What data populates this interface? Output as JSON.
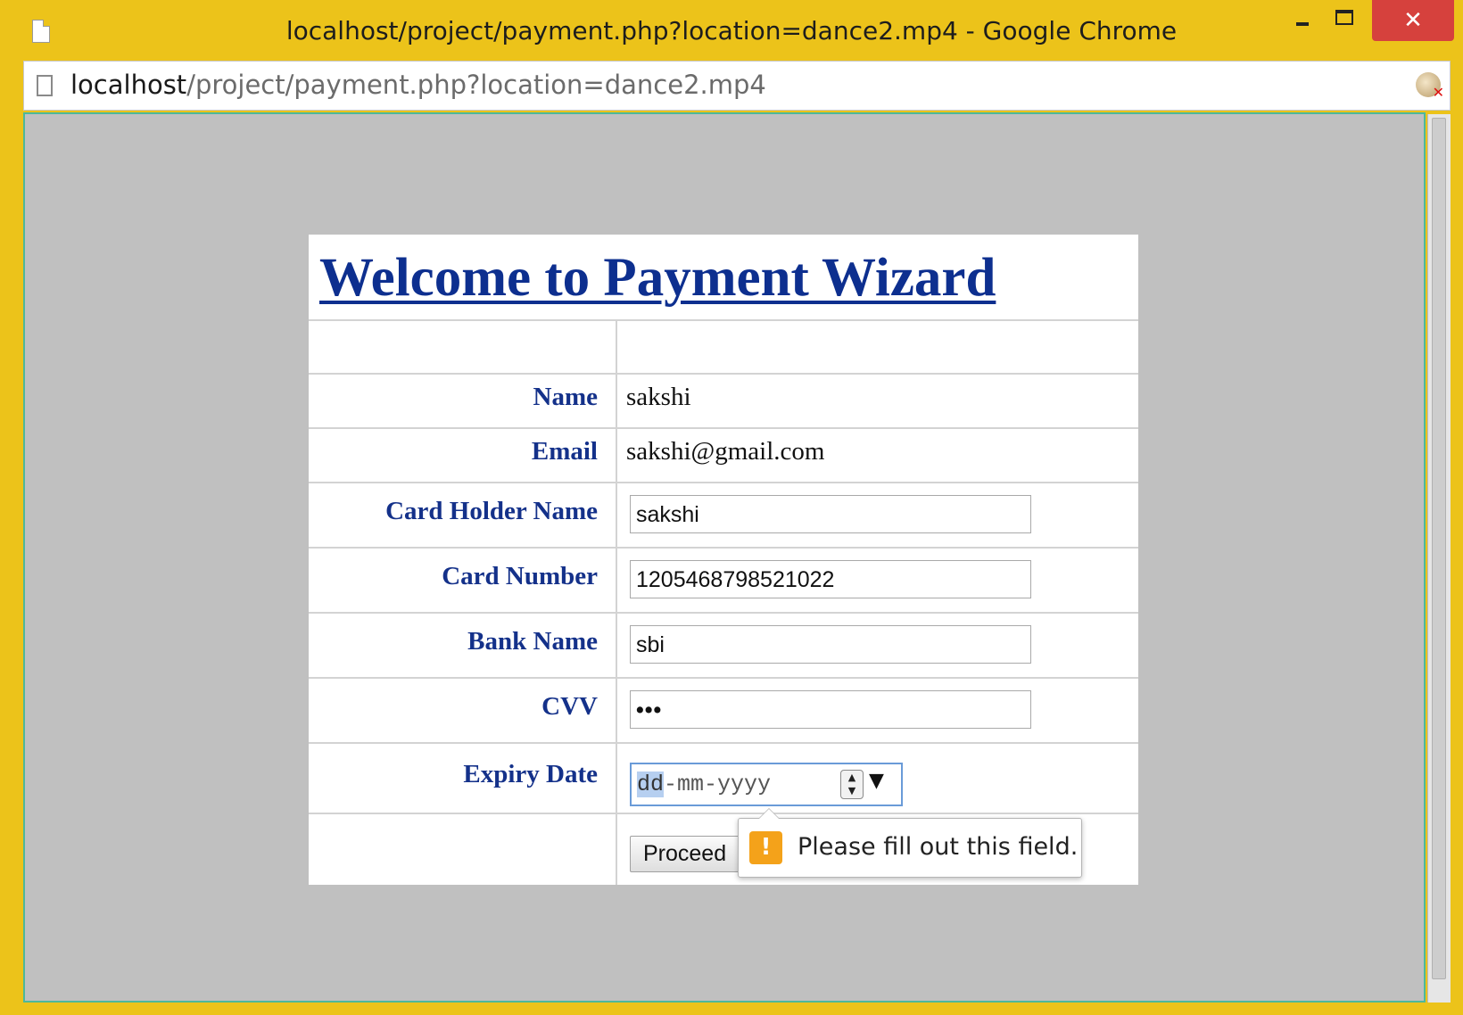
{
  "window": {
    "title": "localhost/project/payment.php?location=dance2.mp4 - Google Chrome",
    "close_glyph": "✕"
  },
  "addressbar": {
    "host": "localhost",
    "path": "/project/payment.php?location=dance2.mp4"
  },
  "page": {
    "heading": "Welcome to Payment Wizard",
    "name_label": "Name",
    "name_value": "sakshi",
    "email_label": "Email",
    "email_value": "sakshi@gmail.com",
    "cardholder_label": "Card Holder Name",
    "cardholder_value": "sakshi",
    "cardnumber_label": "Card Number",
    "cardnumber_value": "1205468798521022",
    "bankname_label": "Bank Name",
    "bankname_value": "sbi",
    "cvv_label": "CVV",
    "cvv_value": "•••",
    "expiry_label": "Expiry Date",
    "expiry_dd": "dd",
    "expiry_rest": "-mm-yyyy",
    "proceed_label": "Proceed"
  },
  "validation": {
    "message": "Please fill out this field.",
    "icon": "!"
  },
  "colors": {
    "window_frame": "#ecc31a",
    "close_button": "#d6413d",
    "heading": "#0d2f8f",
    "label": "#14318a",
    "viewport_bg": "#c0c0c0",
    "warning": "#f4a21a"
  },
  "icons": [
    "document-icon",
    "page-icon",
    "plugin-blocked-icon",
    "warning-icon",
    "spinner-icon",
    "dropdown-arrow-icon"
  ]
}
